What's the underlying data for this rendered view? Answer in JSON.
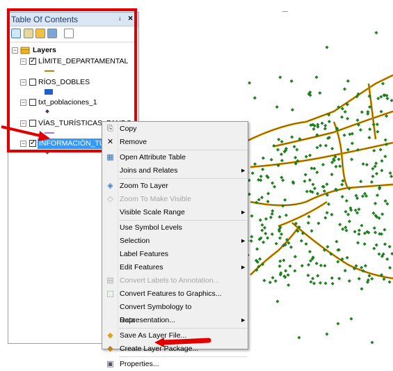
{
  "toc": {
    "title": "Table Of Contents",
    "pin_glyph": "↓",
    "close_glyph": "×",
    "layers_root": "Layers",
    "layers": [
      {
        "name": "LÍMITE_DEPARTAMENTAL",
        "checked": true,
        "symbol": "line-orange"
      },
      {
        "name": "RÍOS_DOBLES",
        "checked": false,
        "symbol": "fill-blue"
      },
      {
        "name": "txt_poblaciones_1",
        "checked": false,
        "symbol": "point-purple"
      },
      {
        "name": "VÍAS_TURÍSTICAS_PANDO",
        "checked": false,
        "symbol": "line-purple"
      },
      {
        "name": "INFORMACIÓN_TU",
        "checked": true,
        "selected": true,
        "symbol": "point-green"
      }
    ]
  },
  "context_menu": {
    "items": [
      {
        "label": "Copy",
        "icon": "copy-icon",
        "enabled": true
      },
      {
        "label": "Remove",
        "icon": "remove-icon",
        "enabled": true
      },
      {
        "label": "Open Attribute Table",
        "icon": "table-icon",
        "enabled": true
      },
      {
        "label": "Joins and Relates",
        "enabled": true,
        "submenu": true
      },
      {
        "label": "Zoom To Layer",
        "icon": "zoom-layer-icon",
        "enabled": true
      },
      {
        "label": "Zoom To Make Visible",
        "icon": "zoom-visible-icon",
        "enabled": false
      },
      {
        "label": "Visible Scale Range",
        "enabled": true,
        "submenu": true
      },
      {
        "label": "Use Symbol Levels",
        "enabled": true
      },
      {
        "label": "Selection",
        "enabled": true,
        "submenu": true
      },
      {
        "label": "Label Features",
        "enabled": true
      },
      {
        "label": "Edit Features",
        "enabled": true,
        "submenu": true
      },
      {
        "label": "Convert Labels to Annotation...",
        "icon": "annotation-icon",
        "enabled": false
      },
      {
        "label": "Convert Features to Graphics...",
        "icon": "graphics-icon",
        "enabled": true
      },
      {
        "label": "Convert Symbology to Representation...",
        "enabled": true
      },
      {
        "label": "Data",
        "enabled": true,
        "submenu": true
      },
      {
        "label": "Save As Layer File...",
        "icon": "layer-file-icon",
        "enabled": true
      },
      {
        "label": "Create Layer Package...",
        "icon": "layer-package-icon",
        "enabled": true
      },
      {
        "label": "Properties...",
        "icon": "properties-icon",
        "enabled": true
      }
    ],
    "submenu_arrow": "▶"
  },
  "colors": {
    "highlight": "#e00000",
    "selection": "#3399ff",
    "boundary": "#c8a200",
    "points": "#1a8a1a"
  }
}
